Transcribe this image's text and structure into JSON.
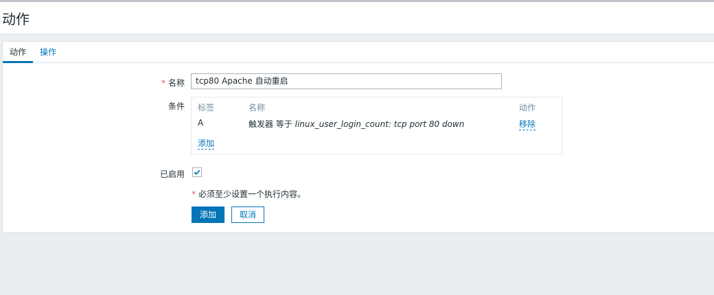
{
  "header": {
    "title": "动作"
  },
  "tabs": [
    {
      "label": "动作",
      "active": true
    },
    {
      "label": "操作",
      "active": false
    }
  ],
  "form": {
    "name_label": "名称",
    "name_value": "tcp80 Apache 自动重启",
    "conditions_label": "条件",
    "conditions": {
      "columns": [
        "标签",
        "名称",
        "动作"
      ],
      "rows": [
        {
          "tag": "A",
          "name_prefix": "触发器 等于 ",
          "name_value": "linux_user_login_count: tcp port 80 down",
          "action": "移除"
        }
      ],
      "add_label": "添加"
    },
    "enabled_label": "已启用",
    "enabled": true,
    "note": "必须至少设置一个执行内容。"
  },
  "buttons": {
    "add": "添加",
    "cancel": "取消"
  },
  "colors": {
    "accent": "#0275b8",
    "required": "#e45959",
    "background": "#ebeef1"
  }
}
